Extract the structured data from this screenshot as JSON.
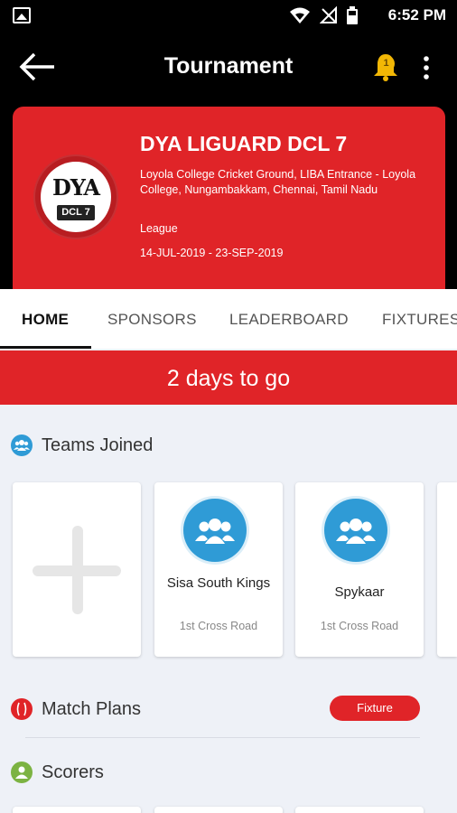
{
  "status_bar": {
    "time": "6:52 PM",
    "icons": [
      "image-icon",
      "wifi-icon",
      "no-signal-icon",
      "battery-icon"
    ]
  },
  "app_bar": {
    "title": "Tournament",
    "notification_count": "1"
  },
  "tournament": {
    "name": "DYA LIGUARD DCL 7",
    "address": "Loyola College Cricket Ground, LIBA Entrance - Loyola College, Nungambakkam, Chennai, Tamil Nadu",
    "type": "League",
    "dates": "14-JUL-2019 - 23-SEP-2019",
    "logo_text": "DYA",
    "logo_subtext": "DCL 7"
  },
  "tabs": [
    {
      "label": "HOME",
      "active": true
    },
    {
      "label": "SPONSORS",
      "active": false
    },
    {
      "label": "LEADERBOARD",
      "active": false
    },
    {
      "label": "FIXTURES",
      "active": false
    }
  ],
  "countdown": "2 days to go",
  "sections": {
    "teams_joined": "Teams Joined",
    "match_plans": "Match Plans",
    "scorers": "Scorers"
  },
  "teams": [
    {
      "name": "Sisa South Kings",
      "location": "1st Cross Road"
    },
    {
      "name": "Spykaar",
      "location": "1st Cross Road"
    }
  ],
  "fixture_button": "Fixture",
  "colors": {
    "brand_red": "#e02428",
    "team_avatar_blue": "#2f9bd6",
    "scorers_green": "#7cb342",
    "badge_yellow": "#f2b705"
  }
}
